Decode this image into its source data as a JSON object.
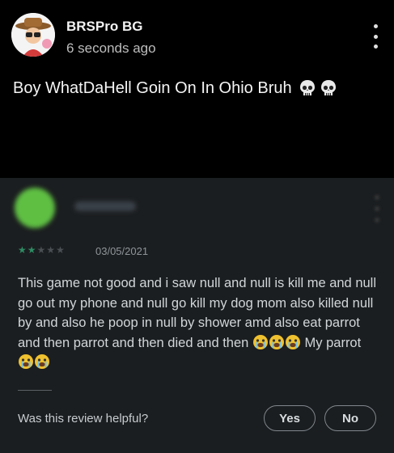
{
  "post": {
    "author": "BRSPro BG",
    "timestamp": "6 seconds ago",
    "text": "Boy WhatDaHell Goin On In Ohio Bruh",
    "emoji": [
      "skull-icon",
      "skull-icon"
    ]
  },
  "review": {
    "rating": 2,
    "max_rating": 5,
    "date": "03/05/2021",
    "body_part1": "This game not good and i saw null and null is kill me and null go out my phone and null go kill my dog mom also killed null by and also he poop in null by shower amd also eat parrot and then parrot and then died and then",
    "body_part2": "My parrot",
    "helpful_question": "Was this review helpful?",
    "yes_label": "Yes",
    "no_label": "No"
  },
  "colors": {
    "background": "#000000",
    "card": "#1b1e20",
    "star": "#2e8b63"
  }
}
